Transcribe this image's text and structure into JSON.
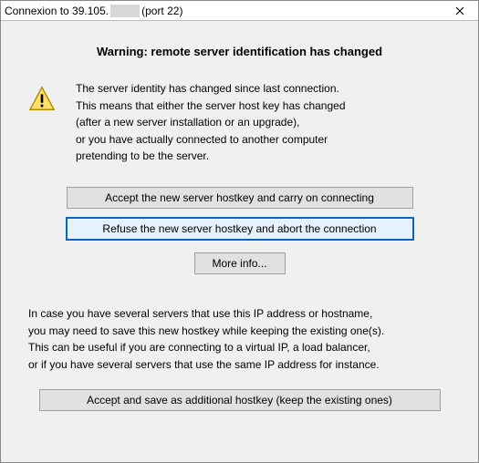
{
  "titlebar": {
    "prefix": "Connexion to 39.105.",
    "suffix": "(port 22)"
  },
  "heading": "Warning: remote server identification has changed",
  "message": {
    "l1": "The server identity has changed since last connection.",
    "l2": "This means that either the server host key has changed",
    "l3": "(after a new server installation or an upgrade),",
    "l4": "or you have actually connected to another computer",
    "l5": "pretending to be the server."
  },
  "buttons": {
    "accept": "Accept the new server hostkey and carry on connecting",
    "refuse": "Refuse the new server hostkey and abort the connection",
    "more": "More info...",
    "save": "Accept and save as additional hostkey (keep the existing ones)"
  },
  "note": {
    "l1": "In case you have several servers that use this IP address or hostname,",
    "l2": "you may need to save this new hostkey while keeping the existing one(s).",
    "l3": "This can be useful if you are connecting to a virtual IP, a load balancer,",
    "l4": "or if you have several servers that use the same IP address for instance."
  }
}
